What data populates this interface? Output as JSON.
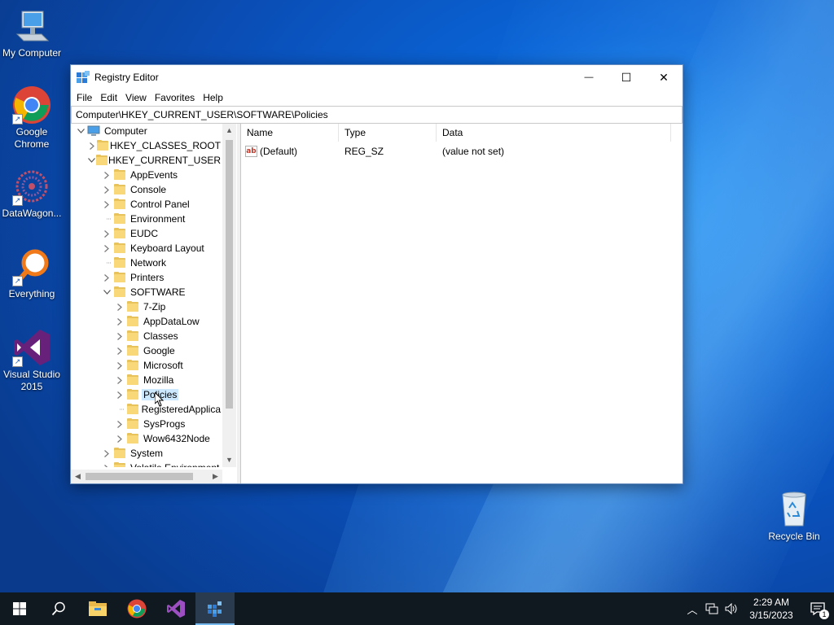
{
  "desktop": {
    "icons": [
      {
        "label": "My Computer",
        "icon": "computer-icon"
      },
      {
        "label": "Google Chrome",
        "icon": "chrome-icon"
      },
      {
        "label": "DataWagon...",
        "icon": "datawagon-icon"
      },
      {
        "label": "Everything",
        "icon": "everything-search-icon"
      },
      {
        "label": "Visual Studio 2015",
        "icon": "visual-studio-icon"
      },
      {
        "label": "Recycle Bin",
        "icon": "recycle-bin-icon"
      }
    ]
  },
  "window": {
    "title": "Registry Editor",
    "controls": {
      "minimize": "—",
      "maximize": "☐",
      "close": "✕"
    },
    "menu": [
      "File",
      "Edit",
      "View",
      "Favorites",
      "Help"
    ],
    "address": "Computer\\HKEY_CURRENT_USER\\SOFTWARE\\Policies",
    "tree": [
      {
        "label": "Computer",
        "expander": "v"
      },
      {
        "label": "HKEY_CLASSES_ROOT",
        "expander": ">"
      },
      {
        "label": "HKEY_CURRENT_USER",
        "expander": "v"
      },
      {
        "label": "AppEvents",
        "expander": ">"
      },
      {
        "label": "Console",
        "expander": ">"
      },
      {
        "label": "Control Panel",
        "expander": ">"
      },
      {
        "label": "Environment",
        "expander": ""
      },
      {
        "label": "EUDC",
        "expander": ">"
      },
      {
        "label": "Keyboard Layout",
        "expander": ">"
      },
      {
        "label": "Network",
        "expander": ""
      },
      {
        "label": "Printers",
        "expander": ">"
      },
      {
        "label": "SOFTWARE",
        "expander": "v"
      },
      {
        "label": "7-Zip",
        "expander": ">"
      },
      {
        "label": "AppDataLow",
        "expander": ">"
      },
      {
        "label": "Classes",
        "expander": ">"
      },
      {
        "label": "Google",
        "expander": ">"
      },
      {
        "label": "Microsoft",
        "expander": ">"
      },
      {
        "label": "Mozilla",
        "expander": ">"
      },
      {
        "label": "Policies",
        "expander": ">",
        "selected": true
      },
      {
        "label": "RegisteredApplica",
        "expander": ""
      },
      {
        "label": "SysProgs",
        "expander": ">"
      },
      {
        "label": "Wow6432Node",
        "expander": ">"
      },
      {
        "label": "System",
        "expander": ">"
      },
      {
        "label": "Volatile Environment",
        "expander": ">"
      }
    ],
    "columns": [
      "Name",
      "Type",
      "Data"
    ],
    "values": [
      {
        "name": "(Default)",
        "type": "REG_SZ",
        "data": "(value not set)"
      }
    ]
  },
  "taskbar": {
    "apps": [
      "start-icon",
      "search-icon",
      "file-explorer-icon",
      "chrome-icon",
      "visual-studio-icon",
      "registry-editor-icon"
    ],
    "clock": {
      "time": "2:29 AM",
      "date": "3/15/2023"
    },
    "notification_count": "1"
  },
  "colors": {
    "accent": "#0078d7",
    "selection": "#cce8ff",
    "taskbar": "#101820"
  }
}
